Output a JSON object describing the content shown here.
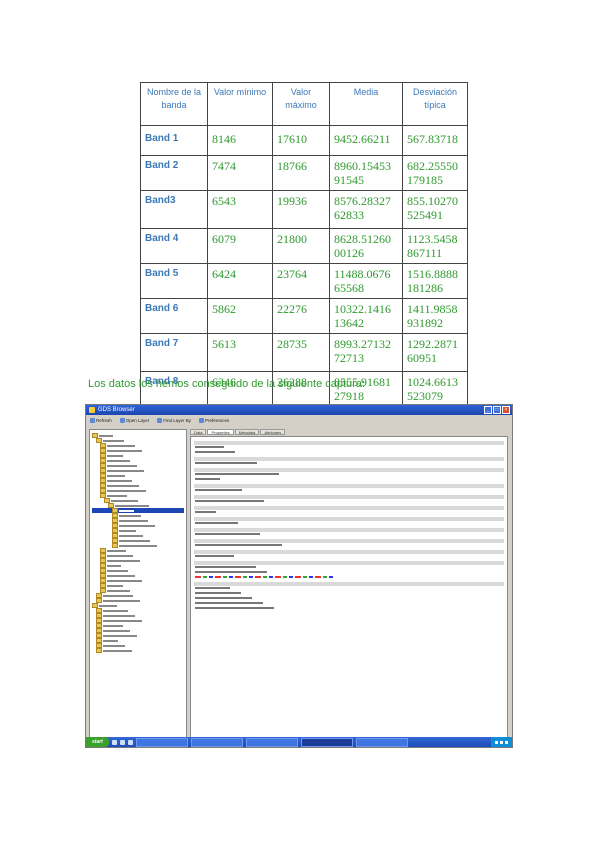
{
  "table": {
    "headers": [
      "Nombre de la banda",
      "Valor mínimo",
      "Valor máximo",
      "Media",
      "Desviación típica"
    ],
    "rows": [
      {
        "band": "Band 1",
        "min": "8146",
        "max": "17610",
        "mean": "9452.66211",
        "std": "567.83718"
      },
      {
        "band": "Band 2",
        "min": "7474",
        "max": "18766",
        "mean": "8960.15453 91545",
        "std": "682.25550 179185"
      },
      {
        "band": "Band3",
        "min": "6543",
        "max": "19936",
        "mean": "8576.28327 62833",
        "std": "855.10270 525491"
      },
      {
        "band": "Band 4",
        "min": "6079",
        "max": "21800",
        "mean": "8628.51260 00126",
        "std": "1123.5458 867111"
      },
      {
        "band": "Band 5",
        "min": "6424",
        "max": "23764",
        "mean": "11488.0676 65568",
        "std": "1516.8888 181286"
      },
      {
        "band": "Band 6",
        "min": "5862",
        "max": "22276",
        "mean": "10322.1416 13642",
        "std": "1411.9858 931892"
      },
      {
        "band": "Band 7",
        "min": "5613",
        "max": "28735",
        "mean": "8993.27132 72713",
        "std": "1292.2871 60951"
      },
      {
        "band": "Band 8",
        "min": "6346",
        "max": "26288",
        "mean": "8555.91681 27918",
        "std": "1024.6613 523079"
      }
    ]
  },
  "caption": "Los datos los hemos conseguido de la siguiente captura:",
  "screenshot": {
    "title": "GDS Browser",
    "toolbar": [
      "Refresh",
      "Open Layer",
      "Find Layer By",
      "Preferences"
    ],
    "tabs": [
      "Data",
      "Properties",
      "Metadata",
      "Attributes"
    ]
  }
}
